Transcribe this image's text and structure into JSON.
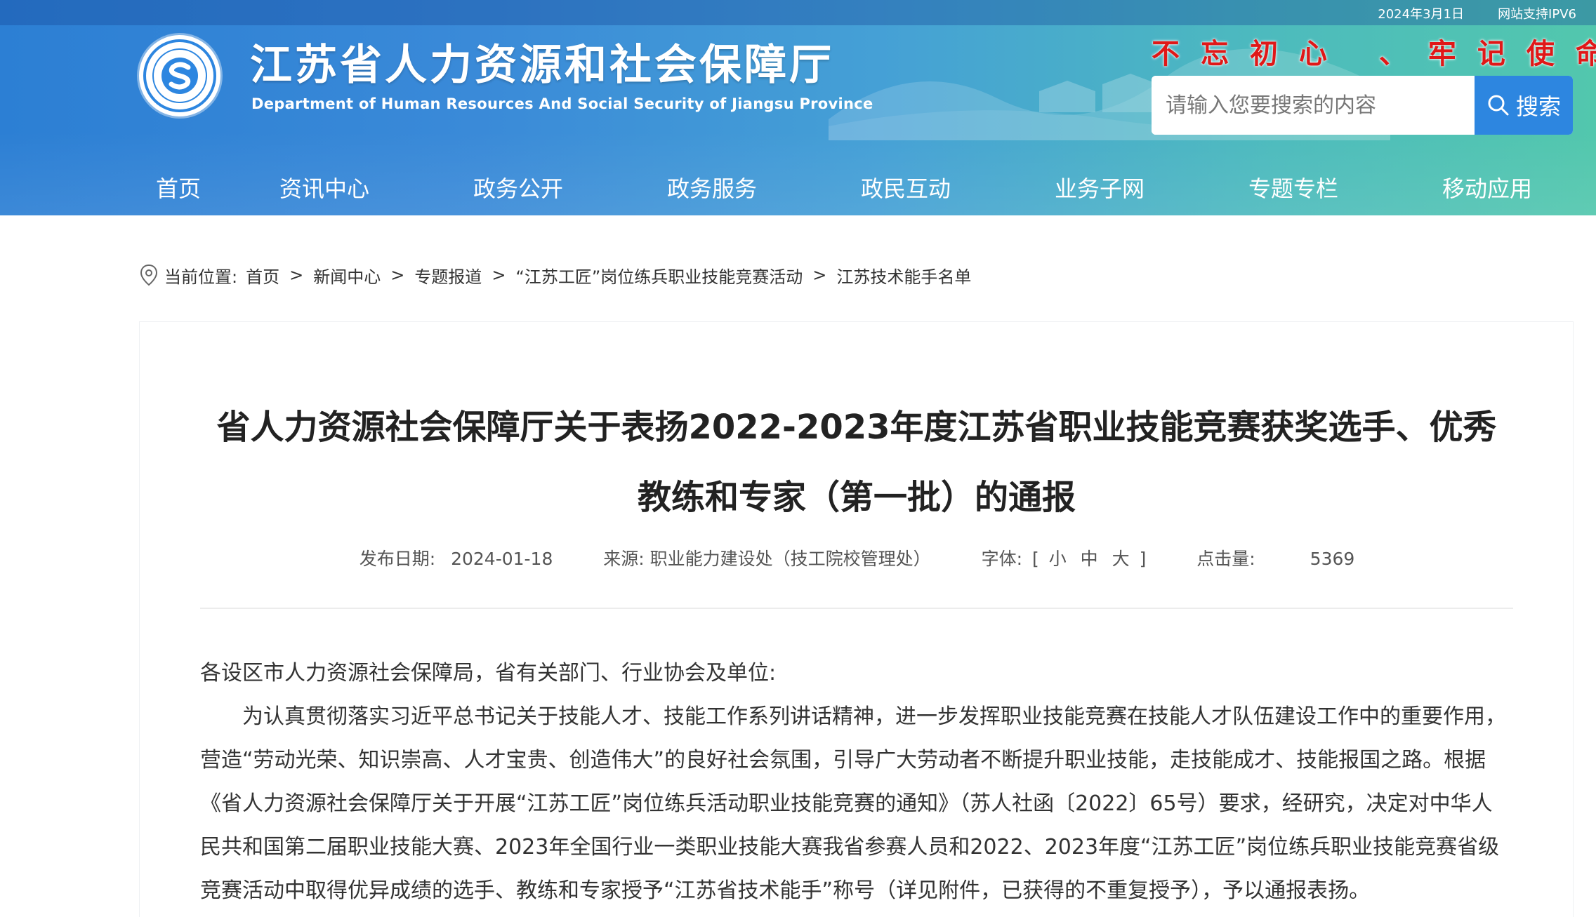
{
  "topbar": {
    "date": "2024年3月1日",
    "ipv6": "网站支持IPV6"
  },
  "site": {
    "title": "江苏省人力资源和社会保障厅",
    "subtitle": "Department of Human Resources And Social Security of Jiangsu Province",
    "logo_icon": "department-seal-logo",
    "slogan": "不忘初心 、牢记使命"
  },
  "search": {
    "placeholder": "请输入您要搜索的内容",
    "button_label": "搜索",
    "icon": "search-icon"
  },
  "nav": {
    "items": [
      {
        "label": "首页"
      },
      {
        "label": "资讯中心"
      },
      {
        "label": "政务公开"
      },
      {
        "label": "政务服务"
      },
      {
        "label": "政民互动"
      },
      {
        "label": "业务子网"
      },
      {
        "label": "专题专栏"
      },
      {
        "label": "移动应用"
      }
    ]
  },
  "breadcrumb": {
    "icon": "location-pin-icon",
    "prefix": "当前位置:",
    "items": [
      "首页",
      "新闻中心",
      "专题报道",
      "“江苏工匠”岗位练兵职业技能竞赛活动",
      "江苏技术能手名单"
    ],
    "separator": ">"
  },
  "article": {
    "title": "省人力资源社会保障厅关于表扬2022-2023年度江苏省职业技能竞赛获奖选手、优秀教练和专家（第一批）的通报",
    "meta": {
      "date_label": "发布日期:",
      "date": "2024-01-18",
      "source_label": "来源:",
      "source": "职业能力建设处（技工院校管理处）",
      "font_label": "字体:",
      "bracket_open": "[",
      "font_small": "小",
      "font_medium": "中",
      "font_large": "大",
      "bracket_close": "]",
      "views_label": "点击量:",
      "views": "5369"
    },
    "salutation": "各设区市人力资源社会保障局，省有关部门、行业协会及单位:",
    "paragraph": "为认真贯彻落实习近平总书记关于技能人才、技能工作系列讲话精神，进一步发挥职业技能竞赛在技能人才队伍建设工作中的重要作用，营造“劳动光荣、知识崇高、人才宝贵、创造伟大”的良好社会氛围，引导广大劳动者不断提升职业技能，走技能成才、技能报国之路。根据《省人力资源社会保障厅关于开展“江苏工匠”岗位练兵活动职业技能竞赛的通知》（苏人社函〔2022〕65号）要求，经研究，决定对中华人民共和国第二届职业技能大赛、2023年全国行业一类职业技能大赛我省参赛人员和2022、2023年度“江苏工匠”岗位练兵职业技能竞赛省级竞赛活动中取得优异成绩的选手、教练和专家授予“江苏省技术能手”称号（详见附件，已获得的不重复授予），予以通报表扬。"
  },
  "colors": {
    "header_start": "#2c7fd4",
    "header_end": "#52c7ad",
    "search_button": "#2d86e0",
    "slogan": "#e01818"
  }
}
